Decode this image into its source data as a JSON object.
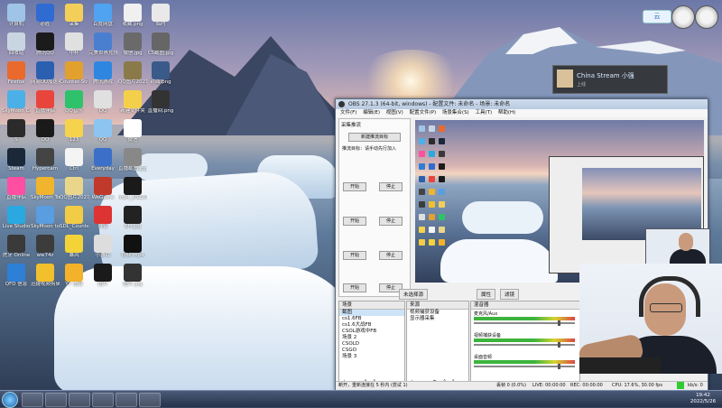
{
  "desktop_icons": [
    {
      "label": "计算机",
      "color": "#9fc4e6"
    },
    {
      "label": "回收站",
      "color": "#c9d6e2"
    },
    {
      "label": "Firefox",
      "color": "#e96a2c"
    },
    {
      "label": "SkyMoon Camera15",
      "color": "#4bb0e8"
    },
    {
      "label": "S",
      "color": "#2b2b2b"
    },
    {
      "label": "Steam",
      "color": "#1b2838"
    },
    {
      "label": "直播伴侣",
      "color": "#ff4fa3"
    },
    {
      "label": "Live Studio",
      "color": "#2aa9e0"
    },
    {
      "label": "虎牙 Online",
      "color": "#3a3a3a"
    },
    {
      "label": "QFD 信息",
      "color": "#2e7fd6"
    },
    {
      "label": "必胜",
      "color": "#2f6bd1"
    },
    {
      "label": "腾讯QQ",
      "color": "#1b1b1b"
    },
    {
      "label": "网易UU加速器",
      "color": "#2b5fb0"
    },
    {
      "label": "直播伴侣",
      "color": "#e8463c"
    },
    {
      "label": "QQ",
      "color": "#1a1a1a"
    },
    {
      "label": "Hypercam",
      "color": "#444"
    },
    {
      "label": "SkyMoon Tools",
      "color": "#f0b52c"
    },
    {
      "label": "SkyMoon tools",
      "color": "#5a9de0"
    },
    {
      "label": "ww74z",
      "color": "#3c3c3c"
    },
    {
      "label": "迅捷视频剪辑",
      "color": "#f2c02c"
    },
    {
      "label": "采集",
      "color": "#f3cf5a"
    },
    {
      "label": "中杯",
      "color": "#e0e0e0"
    },
    {
      "label": "Counter-Strike Global Off",
      "color": "#e2a12e"
    },
    {
      "label": "QQ音乐",
      "color": "#2ec26b"
    },
    {
      "label": "123",
      "color": "#f6d34c"
    },
    {
      "label": "Ctrl",
      "color": "#f4f4f4"
    },
    {
      "label": "QQ图片20211201",
      "color": "#e9d68a"
    },
    {
      "label": "SDL_Counter",
      "color": "#f2cc44"
    },
    {
      "label": "暴风",
      "color": "#f3d338"
    },
    {
      "label": "YY 语音",
      "color": "#f4b22a"
    },
    {
      "label": "百度网盘",
      "color": "#4fa3f0"
    },
    {
      "label": "完美世界竞技平台",
      "color": "#4a7fd0"
    },
    {
      "label": "腾讯游戏",
      "color": "#2f86e0"
    },
    {
      "label": "QQ",
      "color": "#e0e0e0"
    },
    {
      "label": "QQ",
      "color": "#8bc5f0"
    },
    {
      "label": "Everyday",
      "color": "#3b6fc8"
    },
    {
      "label": "WeGame",
      "color": "#c0392b"
    },
    {
      "label": "抖音",
      "color": "#d33"
    },
    {
      "label": "小游戏",
      "color": "#ddd"
    },
    {
      "label": "图片",
      "color": "#1a1a1a"
    },
    {
      "label": "收藏.png",
      "color": "#f0f0f0"
    },
    {
      "label": "微信.jpg",
      "color": "#6a6a6a"
    },
    {
      "label": "QQ图片20210519101.png",
      "color": "#8a7a4a"
    },
    {
      "label": "新建文件夹",
      "color": "#f4d04a"
    },
    {
      "label": "微信",
      "color": "#ffffff"
    },
    {
      "label": "直播截图.jpg",
      "color": "#888"
    },
    {
      "label": "mp4_20220520.mp4",
      "color": "#1a1a1a"
    },
    {
      "label": "BH.jpg",
      "color": "#222"
    },
    {
      "label": "视频.mp4",
      "color": "#111"
    },
    {
      "label": "图片.jpg",
      "color": "#333"
    },
    {
      "label": "临时",
      "color": "#e9e9e9"
    },
    {
      "label": "CS截图.jpg",
      "color": "#666"
    },
    {
      "label": "封面.png",
      "color": "#3a5a8a"
    },
    {
      "label": "直播间.png",
      "color": "#333"
    }
  ],
  "notification": {
    "name": "China Stream 小强",
    "sub": "上线"
  },
  "widget_label": "云",
  "obs": {
    "title": "OBS 27.1.3 (64-bit, windows) - 配置文件: 未命名 - 场景: 未命名",
    "menu": [
      "文件(F)",
      "编辑(E)",
      "视图(V)",
      "配置文件(P)",
      "场景集合(S)",
      "工具(T)",
      "帮助(H)"
    ],
    "left_header": "采集推流",
    "left_button": "新建推流目标",
    "left_hint": "推流目标：请手动先行加入",
    "left_rows": [
      [
        "开始",
        "停止"
      ],
      [
        "开始",
        "停止"
      ],
      [
        "开始",
        "停止"
      ],
      [
        "开始",
        "停止"
      ]
    ],
    "tabs": [
      "未选择源",
      "属性",
      "滤镜"
    ],
    "scenes_header": "场景",
    "scenes": [
      "截图",
      "cs1.6FB",
      "cs1.6大战FB",
      "CSOL游戏中FB",
      "场景 2",
      "CSOLD",
      "CSGO",
      "场景 3"
    ],
    "sources_header": "来源",
    "sources": [
      "视频捕获设备",
      "显示器采集"
    ],
    "mixer_header": "混音器",
    "mixer": [
      "麦克风/Aux",
      "视频捕获设备",
      "桌面音频"
    ],
    "status_left": "断开，重新连接在 5 秒内 (尝试 1)",
    "status_items": [
      "丢帧 0 (0.0%)",
      "LIVE: 00:00:00",
      "REC: 00:00:00",
      "CPU: 17.6%, 30.00 fps",
      "kb/s: 0"
    ]
  },
  "taskbar": {
    "time": "19:42",
    "date": "2022/5/26"
  }
}
